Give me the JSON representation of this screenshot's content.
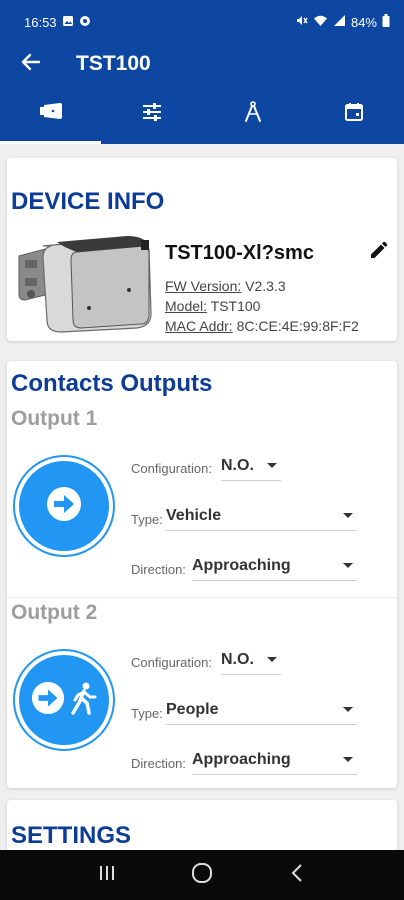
{
  "status_bar": {
    "time": "16:53",
    "battery": "84%"
  },
  "app_bar": {
    "title": "TST100",
    "back_icon": "arrow-left-icon"
  },
  "tabs": [
    {
      "icon": "device-sensor-icon",
      "active": true
    },
    {
      "icon": "sliders-icon",
      "active": false
    },
    {
      "icon": "compass-icon",
      "active": false
    },
    {
      "icon": "calendar-icon",
      "active": false
    }
  ],
  "device_info": {
    "title": "DEVICE INFO",
    "device_name": "TST100-Xl?smc",
    "fw_label": "FW Version:",
    "fw_value": "V2.3.3",
    "model_label": "Model:",
    "model_value": "TST100",
    "mac_label": "MAC Addr:",
    "mac_value": "8C:CE:4E:99:8F:F2"
  },
  "contacts_outputs": {
    "title": "Contacts Outputs",
    "outputs": [
      {
        "label": "Output 1",
        "config_label": "Configuration:",
        "config_value": "N.O.",
        "type_label": "Type:",
        "type_value": "Vehicle",
        "direction_label": "Direction:",
        "direction_value": "Approaching",
        "icons": [
          "arrow-right-circle-icon"
        ]
      },
      {
        "label": "Output 2",
        "config_label": "Configuration:",
        "config_value": "N.O.",
        "type_label": "Type:",
        "type_value": "People",
        "direction_label": "Direction:",
        "direction_value": "Approaching",
        "icons": [
          "arrow-right-circle-icon",
          "walking-person-icon"
        ]
      }
    ]
  },
  "settings": {
    "title": "SETTINGS"
  },
  "colors": {
    "primary": "#0d47a1",
    "accent": "#2196f3",
    "section_title": "#0d3c95"
  }
}
